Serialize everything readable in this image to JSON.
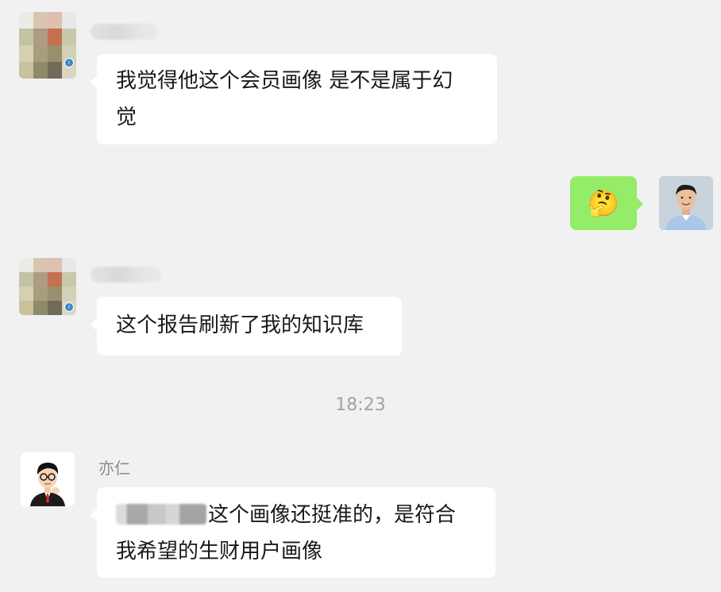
{
  "messages": [
    {
      "sender": "other",
      "name": "",
      "lines": [
        "我觉得他这个会员画像 是不是属于幻",
        "觉"
      ]
    },
    {
      "sender": "self",
      "emoji": "🤔"
    },
    {
      "sender": "other",
      "name": "",
      "lines": [
        "这个报告刷新了我的知识库"
      ]
    },
    {
      "type": "timestamp",
      "text": "18:23"
    },
    {
      "sender": "other",
      "name": "亦仁",
      "lines": [
        "这个画像还挺准的，是符合",
        "我希望的生财用户画像"
      ]
    }
  ]
}
